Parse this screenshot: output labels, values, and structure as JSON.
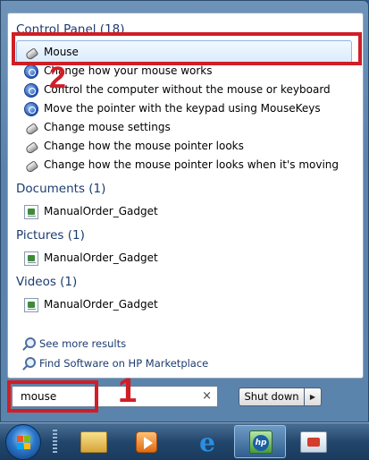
{
  "groups": {
    "control_panel": {
      "header": "Control Panel (18)",
      "items": [
        {
          "label": "Mouse",
          "icon": "mouse-icon"
        },
        {
          "label": "Change how your mouse works",
          "icon": "ease-of-access-icon"
        },
        {
          "label": "Control the computer without the mouse or keyboard",
          "icon": "ease-of-access-icon"
        },
        {
          "label": "Move the pointer with the keypad using MouseKeys",
          "icon": "ease-of-access-icon"
        },
        {
          "label": "Change mouse settings",
          "icon": "mouse-icon"
        },
        {
          "label": "Change how the mouse pointer looks",
          "icon": "mouse-icon"
        },
        {
          "label": "Change how the mouse pointer looks when it's moving",
          "icon": "mouse-icon"
        }
      ]
    },
    "documents": {
      "header": "Documents (1)",
      "items": [
        {
          "label": "ManualOrder_Gadget",
          "icon": "document-icon"
        }
      ]
    },
    "pictures": {
      "header": "Pictures (1)",
      "items": [
        {
          "label": "ManualOrder_Gadget",
          "icon": "document-icon"
        }
      ]
    },
    "videos": {
      "header": "Videos (1)",
      "items": [
        {
          "label": "ManualOrder_Gadget",
          "icon": "document-icon"
        }
      ]
    }
  },
  "links": {
    "see_more": "See more results",
    "find_software": "Find Software on HP Marketplace"
  },
  "search": {
    "value": "mouse",
    "clear_glyph": "×"
  },
  "shutdown": {
    "label": "Shut down",
    "arrow_glyph": "▶"
  },
  "annotations": {
    "one": "1",
    "two": "2"
  },
  "taskbar": {
    "hp_logo_text": "hp"
  },
  "colors": {
    "annotation_red": "#d01e26",
    "highlight_blue": "#d9ebfd",
    "header_blue": "#1c3b70"
  }
}
